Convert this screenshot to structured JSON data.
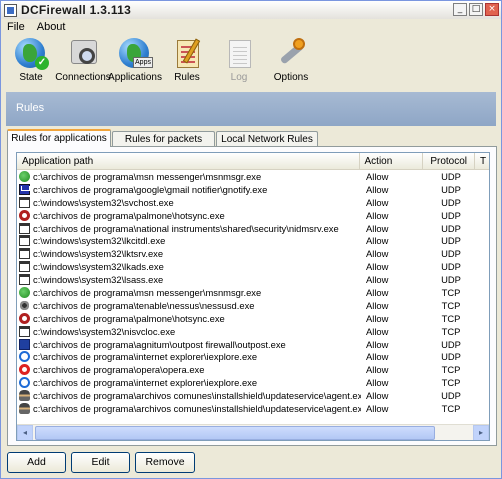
{
  "window": {
    "title": "DCFirewall 1.3.113",
    "controls": [
      "_",
      "□",
      "×"
    ]
  },
  "menubar": {
    "items": [
      "File",
      "About"
    ]
  },
  "toolbar": {
    "items": [
      {
        "label": "State",
        "icon": "globe-check-icon",
        "enabled": true
      },
      {
        "label": "Connections",
        "icon": "connections-magnifier-icon",
        "enabled": true
      },
      {
        "label": "Applications",
        "icon": "globe-apps-icon",
        "enabled": true
      },
      {
        "label": "Rules",
        "icon": "rules-document-icon",
        "enabled": true
      },
      {
        "label": "Log",
        "icon": "log-document-icon",
        "enabled": false
      },
      {
        "label": "Options",
        "icon": "wrench-icon",
        "enabled": true
      }
    ]
  },
  "section": {
    "title": "Rules"
  },
  "tabs": [
    {
      "label": "Rules for applications",
      "active": true
    },
    {
      "label": "Rules for packets",
      "active": false
    },
    {
      "label": "Local Network Rules",
      "active": false
    }
  ],
  "table": {
    "columns": [
      "Application path",
      "Action",
      "Protocol",
      "T"
    ],
    "rows": [
      {
        "icon": "msn",
        "path": "c:\\archivos de programa\\msn messenger\\msnmsgr.exe",
        "action": "Allow",
        "protocol": "UDP"
      },
      {
        "icon": "mail",
        "path": "c:\\archivos de programa\\google\\gmail notifier\\gnotify.exe",
        "action": "Allow",
        "protocol": "UDP"
      },
      {
        "icon": "window",
        "path": "c:\\windows\\system32\\svchost.exe",
        "action": "Allow",
        "protocol": "UDP"
      },
      {
        "icon": "palm",
        "path": "c:\\archivos de programa\\palmone\\hotsync.exe",
        "action": "Allow",
        "protocol": "UDP"
      },
      {
        "icon": "window",
        "path": "c:\\archivos de programa\\national instruments\\shared\\security\\nidmsrv.exe",
        "action": "Allow",
        "protocol": "UDP"
      },
      {
        "icon": "window",
        "path": "c:\\windows\\system32\\lkcitdl.exe",
        "action": "Allow",
        "protocol": "UDP"
      },
      {
        "icon": "window",
        "path": "c:\\windows\\system32\\lktsrv.exe",
        "action": "Allow",
        "protocol": "UDP"
      },
      {
        "icon": "window",
        "path": "c:\\windows\\system32\\lkads.exe",
        "action": "Allow",
        "protocol": "UDP"
      },
      {
        "icon": "window",
        "path": "c:\\windows\\system32\\lsass.exe",
        "action": "Allow",
        "protocol": "UDP"
      },
      {
        "icon": "msn",
        "path": "c:\\archivos de programa\\msn messenger\\msnmsgr.exe",
        "action": "Allow",
        "protocol": "TCP"
      },
      {
        "icon": "nessus",
        "path": "c:\\archivos de programa\\tenable\\nessus\\nessusd.exe",
        "action": "Allow",
        "protocol": "TCP"
      },
      {
        "icon": "palm",
        "path": "c:\\archivos de programa\\palmone\\hotsync.exe",
        "action": "Allow",
        "protocol": "TCP"
      },
      {
        "icon": "window",
        "path": "c:\\windows\\system32\\nisvcloc.exe",
        "action": "Allow",
        "protocol": "TCP"
      },
      {
        "icon": "outpost",
        "path": "c:\\archivos de programa\\agnitum\\outpost firewall\\outpost.exe",
        "action": "Allow",
        "protocol": "UDP"
      },
      {
        "icon": "ie",
        "path": "c:\\archivos de programa\\internet explorer\\iexplore.exe",
        "action": "Allow",
        "protocol": "UDP"
      },
      {
        "icon": "opera",
        "path": "c:\\archivos de programa\\opera\\opera.exe",
        "action": "Allow",
        "protocol": "TCP"
      },
      {
        "icon": "ie",
        "path": "c:\\archivos de programa\\internet explorer\\iexplore.exe",
        "action": "Allow",
        "protocol": "TCP"
      },
      {
        "icon": "agent",
        "path": "c:\\archivos de programa\\archivos comunes\\installshield\\updateservice\\agent.exe",
        "action": "Allow",
        "protocol": "UDP"
      },
      {
        "icon": "agent",
        "path": "c:\\archivos de programa\\archivos comunes\\installshield\\updateservice\\agent.exe",
        "action": "Allow",
        "protocol": "TCP"
      }
    ]
  },
  "buttons": {
    "add": "Add",
    "edit": "Edit",
    "remove": "Remove"
  },
  "scrollbar": {
    "left_arrow": "◂",
    "right_arrow": "▸"
  }
}
